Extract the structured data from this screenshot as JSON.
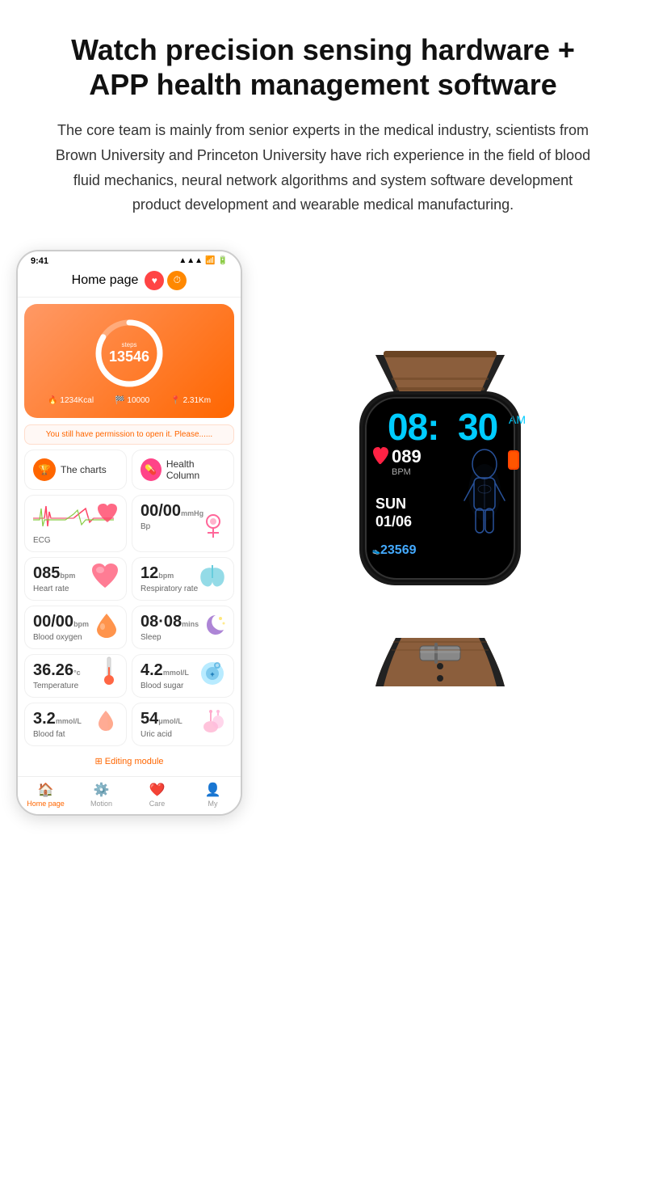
{
  "header": {
    "title": "Watch precision sensing hardware +\nAPP health management software",
    "description": "The core team is mainly from senior experts in the medical industry, scientists from Brown University and Princeton University have rich experience in the field of blood fluid mechanics, neural network algorithms and system software development product development and wearable medical manufacturing."
  },
  "phone": {
    "status_bar": {
      "time": "9:41",
      "signal": "●●●",
      "wifi": "WiFi",
      "battery": "■"
    },
    "home_page_label": "Home page",
    "steps": {
      "label": "steps",
      "value": "13546",
      "calories": "1234Kcal",
      "goal": "10000",
      "distance": "2.31Km"
    },
    "permission_text": "You still have permission to open it. Please......",
    "charts_label": "The charts",
    "health_column_label": "Health Column",
    "metrics": [
      {
        "id": "ecg",
        "label": "ECG",
        "value": "",
        "unit": "",
        "icon": "ecg"
      },
      {
        "id": "bp",
        "label": "Bp",
        "value": "00/00",
        "unit": "mmHg",
        "icon": "bp"
      },
      {
        "id": "heart",
        "label": "Heart rate",
        "value": "085",
        "unit": "bpm",
        "icon": "heart"
      },
      {
        "id": "resp",
        "label": "Respiratory rate",
        "value": "12",
        "unit": "bpm",
        "icon": "lungs"
      },
      {
        "id": "spo2",
        "label": "Blood oxygen",
        "value": "00/00",
        "unit": "bpm",
        "icon": "drop"
      },
      {
        "id": "sleep",
        "label": "Sleep",
        "value": "08·08",
        "unit": "mins",
        "icon": "moon"
      },
      {
        "id": "temp",
        "label": "Temperature",
        "value": "36.26",
        "unit": "°c",
        "icon": "therm"
      },
      {
        "id": "sugar",
        "label": "Blood sugar",
        "value": "4.2",
        "unit": "mmol/L",
        "icon": "sugar"
      },
      {
        "id": "fat",
        "label": "Blood fat",
        "value": "3.2",
        "unit": "mmol/L",
        "icon": "fat"
      },
      {
        "id": "uric",
        "label": "Uric acid",
        "value": "54",
        "unit": "μmol/L",
        "icon": "uric"
      }
    ],
    "editing_module": "Editing module",
    "nav": [
      {
        "label": "Home page",
        "icon": "🏠",
        "active": true
      },
      {
        "label": "Motion",
        "icon": "⚙️",
        "active": false
      },
      {
        "label": "Care",
        "icon": "❤️",
        "active": false
      },
      {
        "label": "My",
        "icon": "👤",
        "active": false
      }
    ]
  },
  "watch": {
    "time": "08:30",
    "am_pm": "AM",
    "heart_icon": "❤️",
    "bpm_value": "089",
    "bpm_label": "BPM",
    "day": "SUN",
    "date": "01/06",
    "steps": "23569",
    "accent_color": "#00ccff"
  }
}
